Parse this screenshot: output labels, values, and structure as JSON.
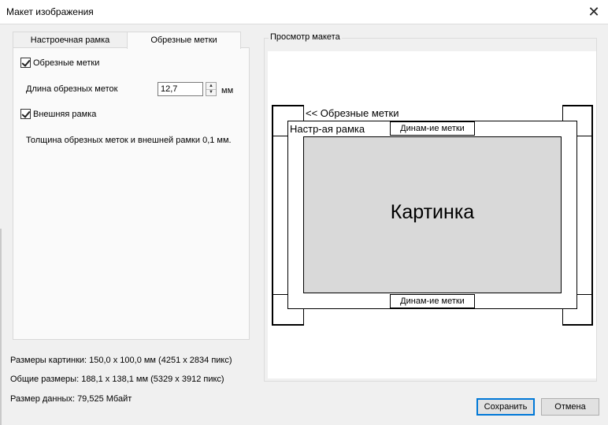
{
  "window": {
    "title": "Макет изображения"
  },
  "tabs": [
    {
      "label": "Настроечная рамка",
      "active": false
    },
    {
      "label": "Обрезные метки",
      "active": true
    }
  ],
  "crop_marks_panel": {
    "crop_marks_checkbox": {
      "label": "Обрезные метки",
      "checked": true
    },
    "length_label": "Длина обрезных меток",
    "length_value": "12,7",
    "length_unit": "мм",
    "outer_frame_checkbox": {
      "label": "Внешняя рамка",
      "checked": true
    },
    "thickness_text": "Толщина обрезных меток и внешней рамки  0,1 мм."
  },
  "preview": {
    "group_title": "Просмотр макета",
    "crop_marks_label": "<< Обрезные метки",
    "frame_label": "Настр-ая рамка",
    "dynamic_top": "Динам-ие метки",
    "dynamic_bottom": "Динам-ие метки",
    "picture_label": "Картинка"
  },
  "info": {
    "picture_size": "Размеры картинки: 150,0 x 100,0 мм (4251 x 2834 пикс)",
    "total_size": "Общие размеры: 188,1 x 138,1 мм (5329 x 3912 пикс)",
    "data_size": "Размер данных: 79,525 Мбайт"
  },
  "buttons": {
    "save": "Сохранить",
    "cancel": "Отмена"
  },
  "colors": {
    "accent": "#0078d7",
    "picture_fill": "#d9d9d9"
  }
}
